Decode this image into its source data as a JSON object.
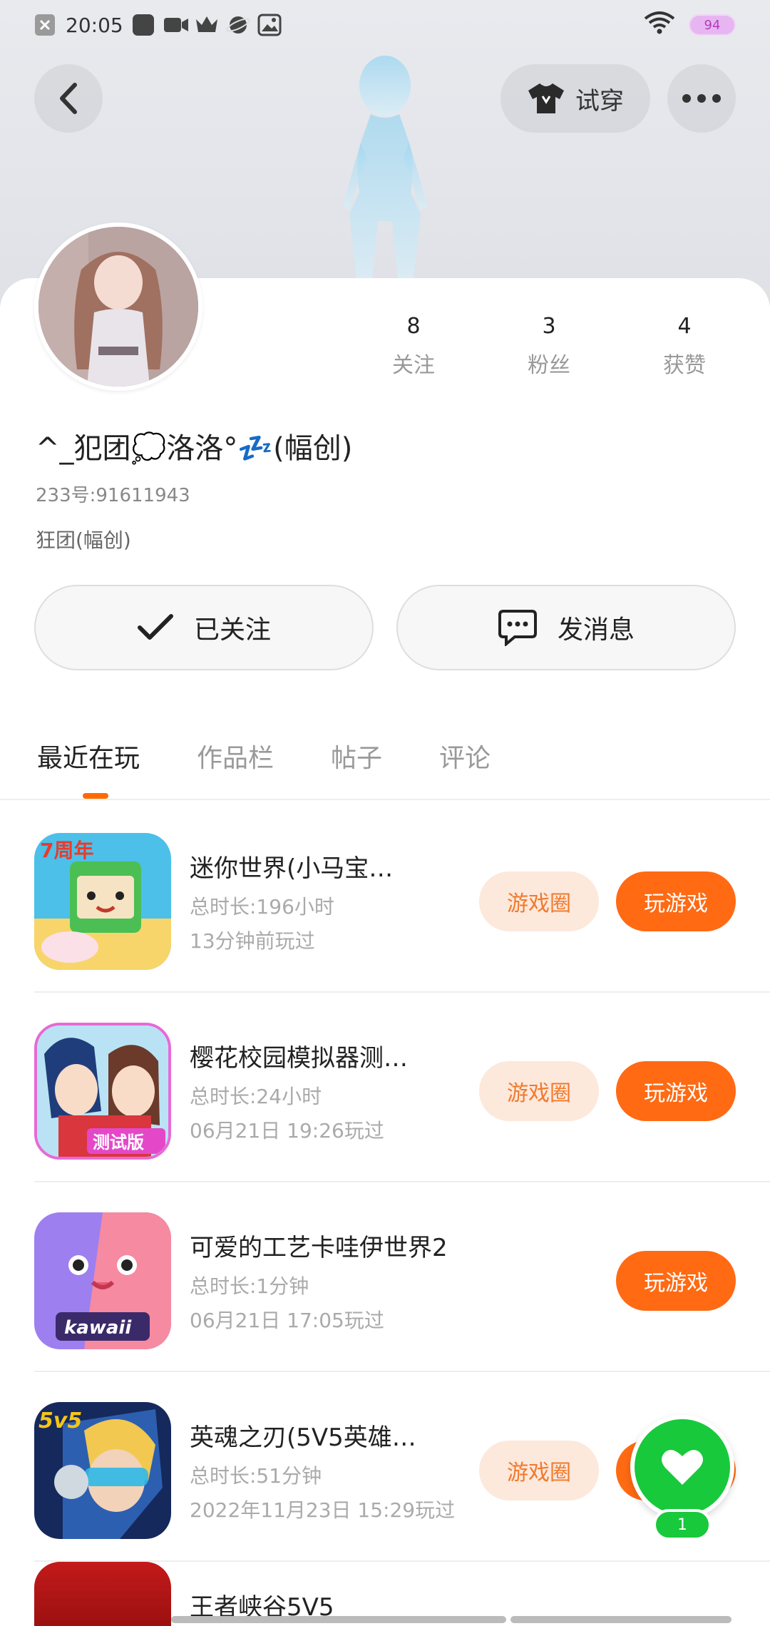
{
  "status_bar": {
    "time": "20:05",
    "battery": "94"
  },
  "header": {
    "try_on_label": "试穿"
  },
  "profile": {
    "nickname": "^_犯团💭洛洛°💤(幅创)",
    "user_id": "233号:91611943",
    "bio": "狂团(幅创)",
    "stats": [
      {
        "value": "8",
        "label": "关注"
      },
      {
        "value": "3",
        "label": "粉丝"
      },
      {
        "value": "4",
        "label": "获赞"
      }
    ]
  },
  "actions": {
    "follow_label": "已关注",
    "message_label": "发消息"
  },
  "tabs": [
    "最近在玩",
    "作品栏",
    "帖子",
    "评论"
  ],
  "games": [
    {
      "title": "迷你世界(小马宝…",
      "duration": "总时长:196小时",
      "last_played": "13分钟前玩过",
      "circle_label": "游戏圈",
      "play_label": "玩游戏",
      "has_circle": true
    },
    {
      "title": "樱花校园模拟器测…",
      "duration": "总时长:24小时",
      "last_played": "06月21日 19:26玩过",
      "circle_label": "游戏圈",
      "play_label": "玩游戏",
      "has_circle": true
    },
    {
      "title": "可爱的工艺卡哇伊世界2",
      "duration": "总时长:1分钟",
      "last_played": "06月21日 17:05玩过",
      "circle_label": "",
      "play_label": "玩游戏",
      "has_circle": false
    },
    {
      "title": "英魂之刃(5V5英雄…",
      "duration": "总时长:51分钟",
      "last_played": "2022年11月23日 15:29玩过",
      "circle_label": "游戏圈",
      "play_label": "玩游戏",
      "has_circle": true
    }
  ],
  "partial_game": {
    "title": "王者峡谷5V5"
  },
  "fab": {
    "badge": "1"
  },
  "icon_texts": {
    "game1": "7周年",
    "game2": "测试版",
    "game3": "kawaii",
    "game4": "5v5"
  },
  "colors": {
    "accent": "#ff6a13",
    "circle_bg": "#fde8dc",
    "fab": "#18c93c"
  }
}
